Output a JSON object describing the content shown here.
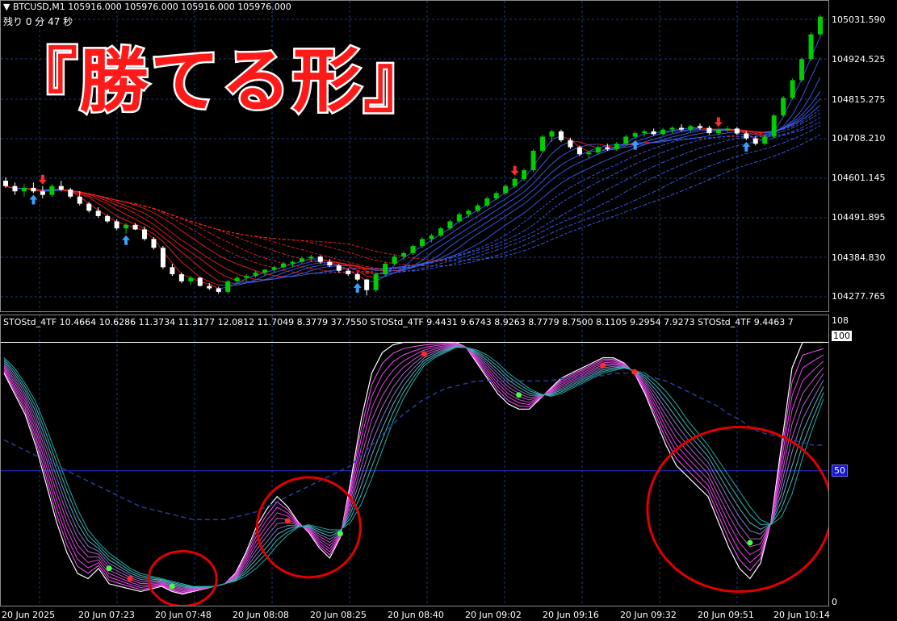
{
  "symbol_header": {
    "arrow": "▼",
    "symbol": "BTCUSD,M1",
    "prices": "105916.000 105976.000 105916.000 105976.000"
  },
  "countdown": "残り 0 分 47 秒",
  "banner": "『勝てる形』",
  "indicator_header": "STOStd_4TF 10.4664 10.6286 11.3734 11.3177 12.0812 11.7049 8.3779 37.7550   STOStd_4TF 9.4431 9.6743 8.9263 8.7779 8.7500 8.1105 9.2954 7.9273   STOStd_4TF 9.4463 7",
  "price_axis": [
    "105031.590",
    "104924.525",
    "104815.275",
    "104708.210",
    "104601.145",
    "104491.895",
    "104384.830",
    "104277.765"
  ],
  "indicator_axis": {
    "top": "108",
    "level_100": "100",
    "level_50": "50",
    "bottom": "0"
  },
  "time_axis": [
    "20 Jun 2025",
    "20 Jun 07:23",
    "20 Jun 07:48",
    "20 Jun 08:08",
    "20 Jun 08:25",
    "20 Jun 08:40",
    "20 Jun 09:02",
    "20 Jun 09:16",
    "20 Jun 09:32",
    "20 Jun 09:51",
    "20 Jun 10:14"
  ],
  "colors": {
    "bull": "#00cc00",
    "bear": "#ffffff",
    "ma_bear": "#ff2222",
    "ma_bull": "#4466ff",
    "grid": "#1e3a78",
    "circle": "#e00000"
  },
  "chart_data": [
    {
      "type": "candlestick",
      "title": "BTCUSD,M1",
      "ylim": [
        104220,
        105100
      ],
      "ohlc": [
        [
          104590,
          104600,
          104570,
          104575
        ],
        [
          104575,
          104585,
          104550,
          104560
        ],
        [
          104560,
          104580,
          104545,
          104570
        ],
        [
          104570,
          104585,
          104555,
          104560
        ],
        [
          104560,
          104575,
          104540,
          104550
        ],
        [
          104550,
          104580,
          104545,
          104575
        ],
        [
          104575,
          104590,
          104560,
          104565
        ],
        [
          104565,
          104570,
          104540,
          104545
        ],
        [
          104545,
          104560,
          104520,
          104525
        ],
        [
          104525,
          104530,
          104500,
          104505
        ],
        [
          104505,
          104515,
          104485,
          104490
        ],
        [
          104490,
          104495,
          104470,
          104475
        ],
        [
          104475,
          104480,
          104450,
          104455
        ],
        [
          104455,
          104470,
          104440,
          104465
        ],
        [
          104465,
          104470,
          104450,
          104452
        ],
        [
          104452,
          104460,
          104420,
          104425
        ],
        [
          104425,
          104430,
          104395,
          104400
        ],
        [
          104400,
          104405,
          104340,
          104345
        ],
        [
          104345,
          104355,
          104320,
          104325
        ],
        [
          104325,
          104330,
          104300,
          104305
        ],
        [
          104305,
          104320,
          104295,
          104315
        ],
        [
          104315,
          104318,
          104290,
          104292
        ],
        [
          104292,
          104300,
          104280,
          104285
        ],
        [
          104285,
          104290,
          104270,
          104275
        ],
        [
          104275,
          104310,
          104270,
          104305
        ],
        [
          104305,
          104320,
          104300,
          104315
        ],
        [
          104315,
          104325,
          104305,
          104320
        ],
        [
          104320,
          104335,
          104315,
          104330
        ],
        [
          104330,
          104340,
          104320,
          104338
        ],
        [
          104338,
          104350,
          104330,
          104345
        ],
        [
          104345,
          104360,
          104340,
          104355
        ],
        [
          104355,
          104365,
          104345,
          104360
        ],
        [
          104360,
          104375,
          104355,
          104370
        ],
        [
          104370,
          104380,
          104360,
          104375
        ],
        [
          104375,
          104378,
          104355,
          104360
        ],
        [
          104360,
          104368,
          104345,
          104350
        ],
        [
          104350,
          104355,
          104330,
          104335
        ],
        [
          104335,
          104340,
          104320,
          104325
        ],
        [
          104325,
          104330,
          104305,
          104310
        ],
        [
          104310,
          104312,
          104265,
          104280
        ],
        [
          104280,
          104330,
          104275,
          104325
        ],
        [
          104325,
          104360,
          104320,
          104355
        ],
        [
          104355,
          104380,
          104350,
          104375
        ],
        [
          104375,
          104390,
          104365,
          104385
        ],
        [
          104385,
          104410,
          104380,
          104405
        ],
        [
          104405,
          104430,
          104400,
          104425
        ],
        [
          104425,
          104440,
          104415,
          104435
        ],
        [
          104435,
          104460,
          104430,
          104455
        ],
        [
          104455,
          104480,
          104450,
          104475
        ],
        [
          104475,
          104500,
          104470,
          104495
        ],
        [
          104495,
          104510,
          104485,
          104505
        ],
        [
          104505,
          104525,
          104500,
          104520
        ],
        [
          104520,
          104545,
          104515,
          104540
        ],
        [
          104540,
          104560,
          104535,
          104555
        ],
        [
          104555,
          104580,
          104550,
          104575
        ],
        [
          104575,
          104600,
          104570,
          104595
        ],
        [
          104595,
          104625,
          104590,
          104620
        ],
        [
          104620,
          104680,
          104615,
          104675
        ],
        [
          104675,
          104720,
          104670,
          104715
        ],
        [
          104715,
          104735,
          104700,
          104730
        ],
        [
          104730,
          104735,
          104700,
          104705
        ],
        [
          104705,
          104712,
          104680,
          104685
        ],
        [
          104685,
          104690,
          104660,
          104665
        ],
        [
          104665,
          104675,
          104655,
          104670
        ],
        [
          104670,
          104690,
          104665,
          104685
        ],
        [
          104685,
          104695,
          104675,
          104680
        ],
        [
          104680,
          104700,
          104675,
          104695
        ],
        [
          104695,
          104720,
          104690,
          104715
        ],
        [
          104715,
          104730,
          104710,
          104725
        ],
        [
          104725,
          104735,
          104715,
          104730
        ],
        [
          104730,
          104738,
          104718,
          104722
        ],
        [
          104722,
          104740,
          104718,
          104735
        ],
        [
          104735,
          104745,
          104725,
          104740
        ],
        [
          104740,
          104750,
          104730,
          104735
        ],
        [
          104735,
          104748,
          104728,
          104745
        ],
        [
          104745,
          104752,
          104735,
          104740
        ],
        [
          104740,
          104746,
          104720,
          104725
        ],
        [
          104725,
          104738,
          104720,
          104735
        ],
        [
          104735,
          104745,
          104728,
          104738
        ],
        [
          104738,
          104742,
          104720,
          104724
        ],
        [
          104724,
          104730,
          104705,
          104710
        ],
        [
          104710,
          104715,
          104690,
          104695
        ],
        [
          104695,
          104720,
          104690,
          104715
        ],
        [
          104715,
          104780,
          104710,
          104775
        ],
        [
          104775,
          104830,
          104770,
          104825
        ],
        [
          104825,
          104880,
          104820,
          104875
        ],
        [
          104875,
          104940,
          104870,
          104935
        ],
        [
          104935,
          105010,
          104930,
          105005
        ],
        [
          105005,
          105060,
          105000,
          105055
        ]
      ]
    },
    {
      "type": "line",
      "title": "STOStd_4TF",
      "ylim": [
        0,
        108
      ],
      "levels": [
        100,
        50
      ],
      "series": [
        {
          "values": [
            88,
            80,
            72,
            60,
            45,
            30,
            18,
            10,
            8,
            12,
            6,
            5,
            4,
            3,
            4,
            5,
            3,
            2,
            3,
            4,
            5,
            6,
            10,
            18,
            28,
            35,
            40,
            36,
            30,
            26,
            20,
            16,
            24,
            46,
            70,
            88,
            96,
            99,
            100,
            100,
            100,
            100,
            100,
            100,
            98,
            92,
            86,
            80,
            76,
            74,
            74,
            78,
            82,
            86,
            88,
            90,
            92,
            94,
            94,
            92,
            88,
            80,
            70,
            60,
            52,
            48,
            44,
            40,
            30,
            20,
            12,
            8,
            14,
            30,
            60,
            90,
            100,
            100,
            100
          ]
        },
        {
          "values": [
            90,
            84,
            76,
            66,
            52,
            38,
            26,
            16,
            12,
            12,
            9,
            7,
            6,
            5,
            5,
            5,
            4,
            3,
            3,
            4,
            5,
            6,
            8,
            13,
            20,
            27,
            33,
            35,
            33,
            30,
            26,
            22,
            24,
            36,
            54,
            72,
            86,
            93,
            97,
            99,
            100,
            100,
            100,
            100,
            99,
            95,
            90,
            85,
            80,
            77,
            75,
            76,
            79,
            83,
            86,
            88,
            90,
            92,
            93,
            92,
            90,
            85,
            78,
            70,
            62,
            56,
            50,
            45,
            38,
            30,
            22,
            16,
            16,
            24,
            44,
            70,
            88,
            97,
            100
          ]
        },
        {
          "values": [
            92,
            87,
            80,
            71,
            59,
            46,
            34,
            24,
            18,
            15,
            12,
            10,
            8,
            7,
            6,
            6,
            5,
            4,
            4,
            4,
            5,
            6,
            7,
            10,
            15,
            21,
            27,
            31,
            32,
            31,
            29,
            26,
            26,
            32,
            44,
            58,
            72,
            83,
            90,
            95,
            98,
            99,
            100,
            100,
            99,
            97,
            93,
            89,
            84,
            80,
            78,
            77,
            78,
            81,
            84,
            86,
            88,
            90,
            91,
            91,
            90,
            87,
            82,
            76,
            69,
            63,
            57,
            51,
            45,
            38,
            31,
            25,
            22,
            24,
            34,
            52,
            70,
            84,
            92
          ]
        },
        {
          "values": [
            94,
            90,
            84,
            77,
            67,
            56,
            45,
            35,
            27,
            22,
            18,
            15,
            12,
            10,
            9,
            8,
            7,
            6,
            5,
            5,
            5,
            6,
            7,
            9,
            12,
            16,
            21,
            25,
            28,
            29,
            28,
            27,
            27,
            30,
            37,
            47,
            58,
            69,
            78,
            85,
            91,
            94,
            96,
            98,
            98,
            97,
            95,
            92,
            88,
            85,
            82,
            80,
            79,
            80,
            82,
            84,
            86,
            88,
            89,
            90,
            89,
            88,
            85,
            81,
            76,
            70,
            65,
            60,
            54,
            48,
            42,
            36,
            31,
            29,
            32,
            41,
            55,
            67,
            78
          ]
        },
        {
          "values": [
            62,
            60,
            58,
            56,
            54,
            52,
            50,
            48,
            46,
            44,
            42,
            40,
            38,
            36,
            35,
            34,
            33,
            32,
            31,
            31,
            31,
            31,
            32,
            33,
            34,
            36,
            38,
            40,
            42,
            44,
            46,
            48,
            50,
            52,
            56,
            60,
            64,
            68,
            72,
            75,
            78,
            80,
            82,
            83,
            84,
            85,
            85,
            85,
            85,
            85,
            85,
            85,
            85,
            86,
            86,
            87,
            87,
            87,
            88,
            88,
            88,
            87,
            86,
            85,
            83,
            81,
            79,
            77,
            75,
            72,
            70,
            67,
            65,
            64,
            63,
            62,
            61,
            60,
            60
          ]
        }
      ]
    }
  ]
}
